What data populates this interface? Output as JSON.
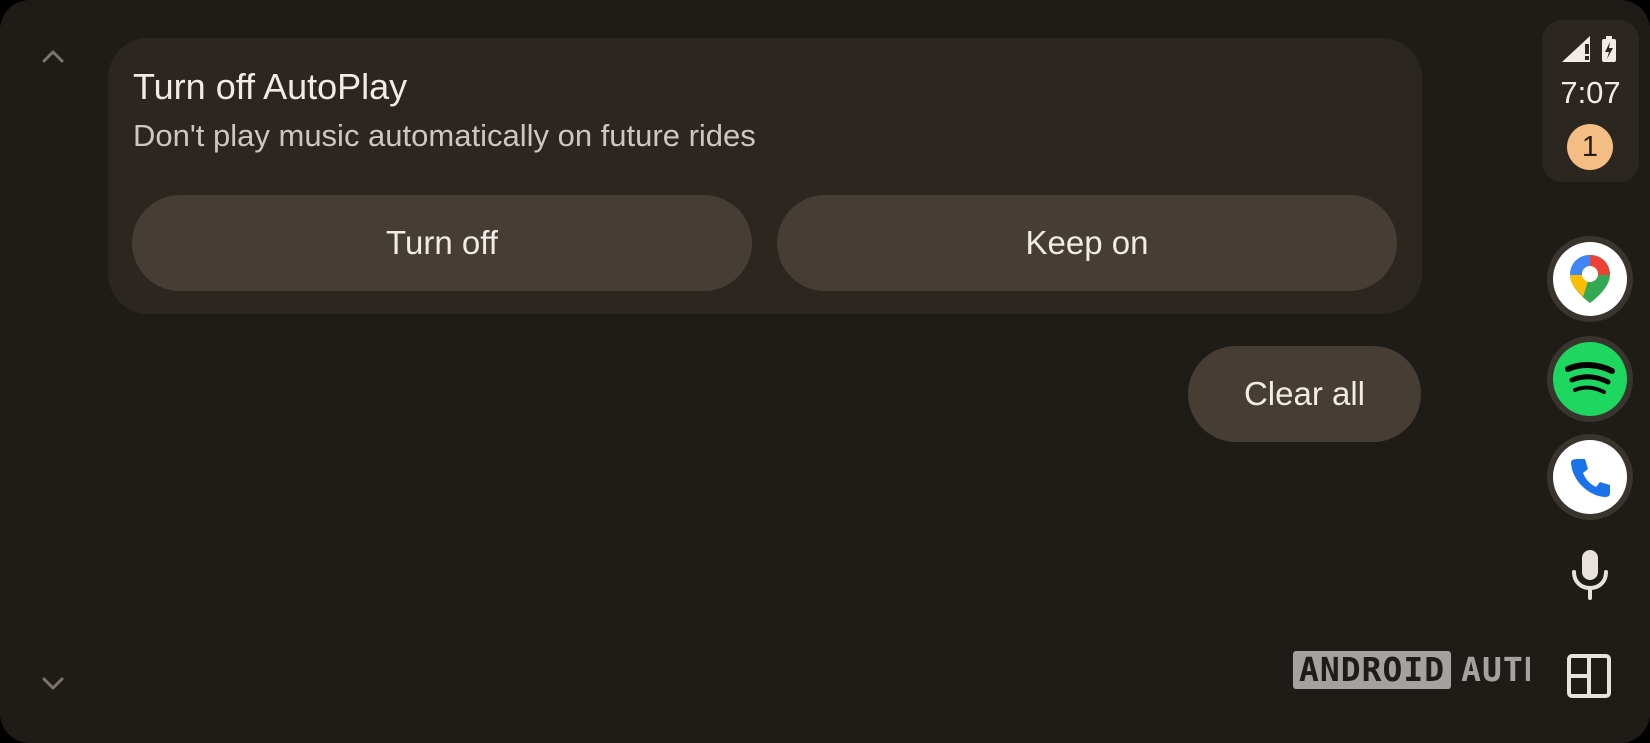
{
  "notification": {
    "title": "Turn off AutoPlay",
    "subtitle": "Don't play music automatically on future rides",
    "primary_action": "Turn off",
    "secondary_action": "Keep on"
  },
  "actions": {
    "clear_all": "Clear all"
  },
  "scroll": {
    "up_icon": "chevron-up-icon",
    "down_icon": "chevron-down-icon"
  },
  "status": {
    "signal_icon": "cellular-signal-icon",
    "battery_icon": "battery-charging-icon",
    "time": "7:07",
    "notification_count": "1"
  },
  "rail_apps": [
    {
      "name": "Google Maps",
      "icon": "maps-pin-icon"
    },
    {
      "name": "Spotify",
      "icon": "spotify-icon"
    },
    {
      "name": "Phone",
      "icon": "phone-icon"
    }
  ],
  "rail_controls": {
    "mic_icon": "microphone-icon",
    "dashboard_icon": "dashboard-layout-icon"
  },
  "watermark": {
    "boxed": "ANDROID",
    "plain": "AUTHORITY"
  },
  "colors": {
    "background": "#1f1c18",
    "card": "#2b2620",
    "button": "#463d35",
    "text_primary": "#f1ece6",
    "text_secondary": "#cfc7bf",
    "badge": "#f3bd84",
    "spotify_green": "#1ed760",
    "phone_blue": "#1a73e8"
  }
}
